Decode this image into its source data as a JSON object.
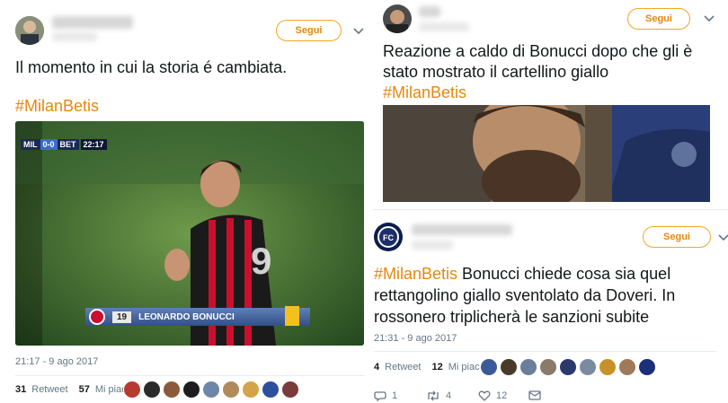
{
  "left_tweet": {
    "follow_label": "Segui",
    "text": "Il momento in cui la storia é cambiata.",
    "hashtag": "#MilanBetis",
    "scoreboard": {
      "home": "MIL",
      "score": "0-0",
      "away": "BET",
      "clock": "22:17"
    },
    "caption_number": "19",
    "caption_name": "LEONARDO BONUCCI",
    "timestamp": "21:17 - 9 ago 2017",
    "retweets_count": "31",
    "retweets_label": "Retweet",
    "likes_count": "57",
    "likes_label": "Mi piace"
  },
  "right_top_tweet": {
    "follow_label": "Segui",
    "text_line1": "Reazione a caldo di Bonucci dopo che gli è",
    "text_line2": "stato mostrato il cartellino giallo",
    "hashtag": "#MilanBetis"
  },
  "right_bottom_tweet": {
    "follow_label": "Segui",
    "hashtag": "#MilanBetis",
    "text_line1_rest": " Bonucci chiede cosa sia quel",
    "text_line2": "rettangolino giallo sventolato da Doveri. In",
    "text_line3": "rossonero triplicherà le sanzioni subite",
    "timestamp": "21:31 - 9 ago 2017",
    "retweets_count": "4",
    "retweets_label": "Retweet",
    "likes_count": "12",
    "likes_label": "Mi piace",
    "reply_count": "1",
    "rt_action_count": "4",
    "like_action_count": "12"
  },
  "colors": {
    "accent": "#e8870d",
    "milan_red": "#c8102e"
  }
}
